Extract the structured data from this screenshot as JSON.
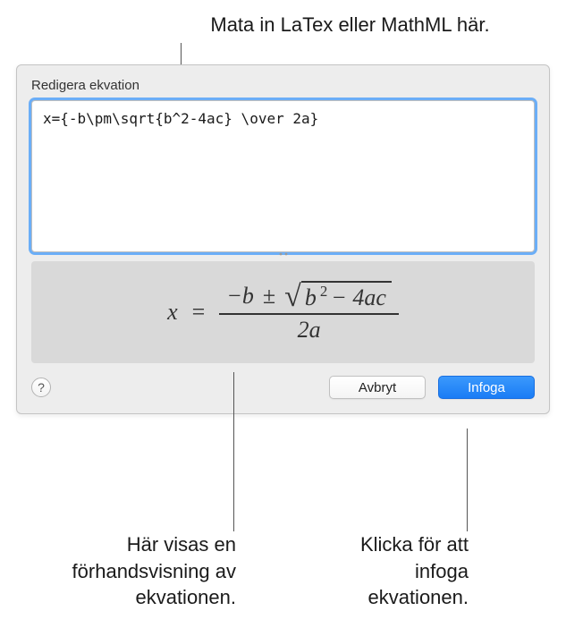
{
  "annotations": {
    "top": "Mata in LaTex eller MathML här.",
    "preview": "Här visas en förhandsvisning av ekvationen.",
    "insert": "Klicka för att infoga ekvationen."
  },
  "dialog": {
    "title": "Redigera ekvation",
    "editor_value": "x={-b\\pm\\sqrt{b^2-4ac} \\over 2a}",
    "buttons": {
      "help_label": "?",
      "cancel_label": "Avbryt",
      "insert_label": "Infoga"
    }
  },
  "preview_equation": {
    "lhs": "x",
    "eq": "=",
    "numerator_prefix": "−b",
    "plus_minus": "±",
    "sqrt_inner_b2": "b",
    "sqrt_exp": "2",
    "sqrt_minus": " − 4ac",
    "denominator": "2a"
  }
}
